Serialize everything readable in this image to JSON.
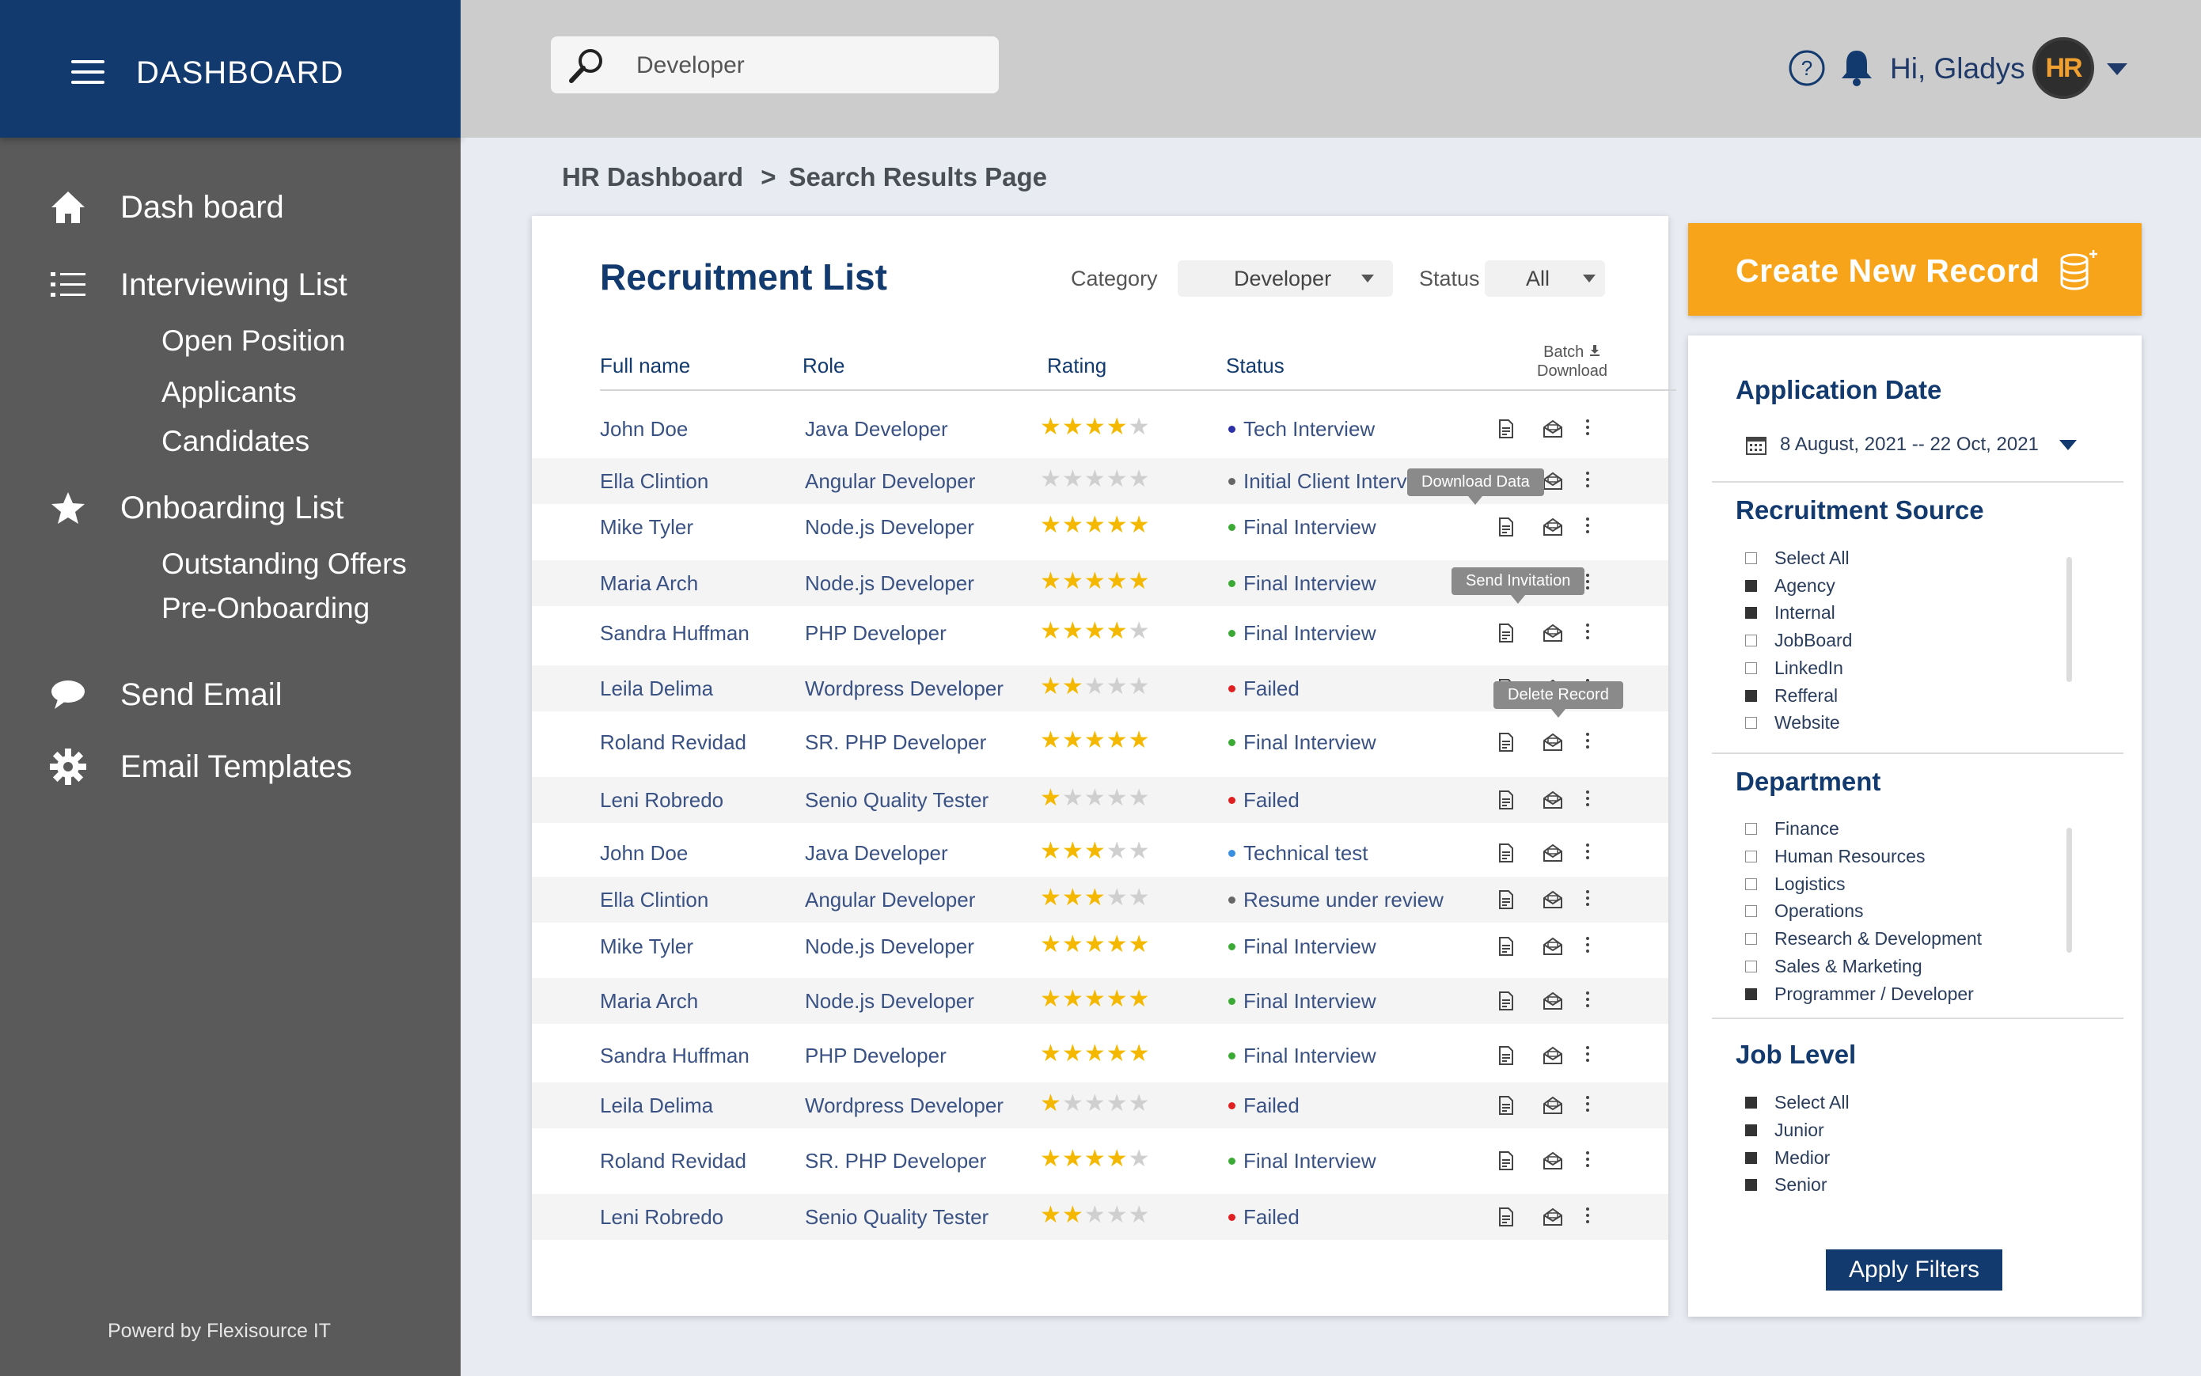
{
  "sidebar": {
    "title": "DASHBOARD",
    "items": [
      {
        "label": "Dash board",
        "icon": "home-icon"
      },
      {
        "label": "Interviewing List",
        "icon": "list-icon"
      },
      {
        "label": "Onboarding List",
        "icon": "star-icon"
      },
      {
        "label": "Send Email",
        "icon": "chat-icon"
      },
      {
        "label": "Email Templates",
        "icon": "gear-icon"
      }
    ],
    "interviewing_sub": [
      "Open Position",
      "Applicants",
      "Candidates"
    ],
    "onboarding_sub": [
      "Outstanding Offers",
      "Pre-Onboarding"
    ],
    "footer": "Powerd by Flexisource IT"
  },
  "topbar": {
    "search_value": "Developer",
    "greeting": "Hi, Gladys !",
    "avatar_text": "HR"
  },
  "breadcrumb": {
    "root": "HR Dashboard",
    "separator": ">",
    "current": "Search Results Page"
  },
  "main": {
    "title": "Recruitment List",
    "category_label": "Category",
    "category_value": "Developer",
    "status_label": "Status",
    "status_value": "All",
    "columns": {
      "name": "Full name",
      "role": "Role",
      "rating": "Rating",
      "status": "Status"
    },
    "batch_line1": "Batch",
    "batch_line2": "Download",
    "tooltips": {
      "download": "Download Data",
      "invite": "Send Invitation",
      "delete": "Delete Record"
    },
    "rows": [
      {
        "name": "John Doe",
        "role": "Java Developer",
        "rating": 4,
        "status": "Tech Interview",
        "dot": "#2b2fa8"
      },
      {
        "name": "Ella Clintion",
        "role": "Angular Developer",
        "rating": 0,
        "status": "Initial Client Interv",
        "dot": "#666666"
      },
      {
        "name": "Mike Tyler",
        "role": "Node.js Developer",
        "rating": 5,
        "status": "Final Interview",
        "dot": "#3aaa35"
      },
      {
        "name": "Maria Arch",
        "role": "Node.js Developer",
        "rating": 5,
        "status": "Final Interview",
        "dot": "#3aaa35"
      },
      {
        "name": "Sandra Huffman",
        "role": "PHP Developer",
        "rating": 4,
        "status": "Final Interview",
        "dot": "#3aaa35"
      },
      {
        "name": "Leila Delima",
        "role": "Wordpress Developer",
        "rating": 2,
        "status": "Failed",
        "dot": "#e02020"
      },
      {
        "name": "Roland Revidad",
        "role": "SR. PHP Developer",
        "rating": 5,
        "status": "Final Interview",
        "dot": "#3aaa35"
      },
      {
        "name": "Leni Robredo",
        "role": "Senio Quality Tester",
        "rating": 1,
        "status": "Failed",
        "dot": "#e02020"
      },
      {
        "name": "John Doe",
        "role": "Java Developer",
        "rating": 3,
        "status": "Technical test",
        "dot": "#3b8fe0"
      },
      {
        "name": "Ella Clintion",
        "role": "Angular Developer",
        "rating": 3,
        "status": "Resume under review",
        "dot": "#666666"
      },
      {
        "name": "Mike Tyler",
        "role": "Node.js Developer",
        "rating": 5,
        "status": "Final Interview",
        "dot": "#3aaa35"
      },
      {
        "name": "Maria Arch",
        "role": "Node.js Developer",
        "rating": 5,
        "status": "Final Interview",
        "dot": "#3aaa35"
      },
      {
        "name": "Sandra Huffman",
        "role": "PHP Developer",
        "rating": 5,
        "status": "Final Interview",
        "dot": "#3aaa35"
      },
      {
        "name": "Leila Delima",
        "role": "Wordpress Developer",
        "rating": 1,
        "status": "Failed",
        "dot": "#e02020"
      },
      {
        "name": "Roland Revidad",
        "role": "SR. PHP Developer",
        "rating": 4,
        "status": "Final Interview",
        "dot": "#3aaa35"
      },
      {
        "name": "Leni Robredo",
        "role": "Senio Quality Tester",
        "rating": 2,
        "status": "Failed",
        "dot": "#e02020"
      }
    ]
  },
  "right": {
    "create_label": "Create New Record",
    "application_date_title": "Application Date",
    "date_range": "8 August, 2021 -- 22 Oct, 2021",
    "recruitment_source_title": "Recruitment Source",
    "recruitment_source": [
      {
        "label": "Select All",
        "checked": false
      },
      {
        "label": "Agency",
        "checked": true
      },
      {
        "label": "Internal",
        "checked": true
      },
      {
        "label": "JobBoard",
        "checked": false
      },
      {
        "label": "LinkedIn",
        "checked": false
      },
      {
        "label": "Refferal",
        "checked": true
      },
      {
        "label": "Website",
        "checked": false
      }
    ],
    "department_title": "Department",
    "department": [
      {
        "label": "Finance",
        "checked": false
      },
      {
        "label": "Human Resources",
        "checked": false
      },
      {
        "label": "Logistics",
        "checked": false
      },
      {
        "label": "Operations",
        "checked": false
      },
      {
        "label": "Research & Development",
        "checked": false
      },
      {
        "label": "Sales & Marketing",
        "checked": false
      },
      {
        "label": "Programmer / Developer",
        "checked": true
      }
    ],
    "job_level_title": "Job Level",
    "job_level": [
      {
        "label": "Select All",
        "checked": true
      },
      {
        "label": "Junior",
        "checked": true
      },
      {
        "label": "Medior",
        "checked": true
      },
      {
        "label": "Senior",
        "checked": true
      }
    ],
    "apply_label": "Apply Filters"
  },
  "colors": {
    "sidebar_head": "#123a6e",
    "sidebar_bg": "#5a5a5a",
    "accent_orange": "#f7a41b",
    "star": "#f5b800",
    "status_green": "#3aaa35",
    "status_red": "#e02020"
  }
}
